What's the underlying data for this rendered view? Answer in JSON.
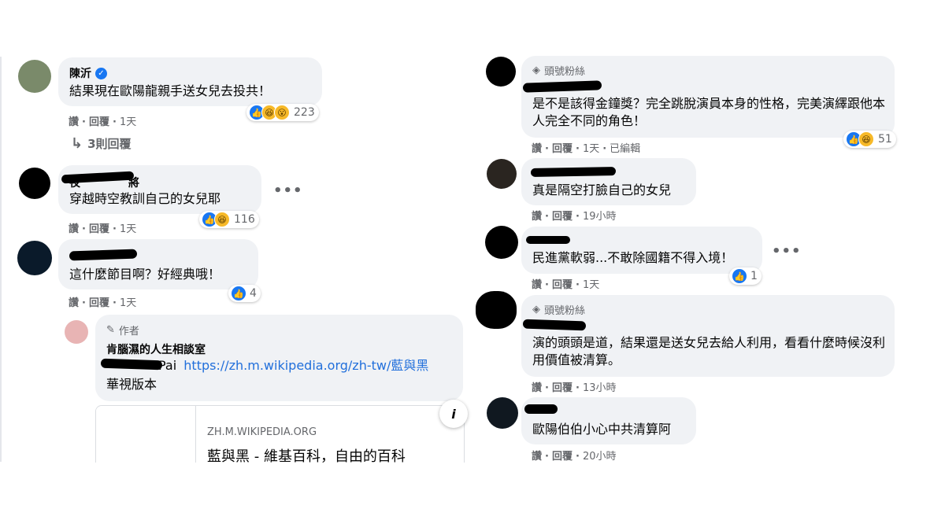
{
  "left": {
    "c1": {
      "name": "陳沂",
      "text": "結果現在歐陽龍親手送女兒去投共！",
      "reactions": "223",
      "actions": [
        "讚",
        "·",
        "回覆",
        "·",
        "1天"
      ],
      "replies_label": "3則回覆"
    },
    "c2": {
      "name_partial": "夜",
      "name_tail": "將",
      "text": "穿越時空教訓自己的女兒耶",
      "reactions": "116",
      "actions": [
        "讚",
        "·",
        "回覆",
        "·",
        "1天"
      ]
    },
    "c3": {
      "text": "這什麼節目啊？好經典哦！",
      "reactions": "4",
      "actions": [
        "讚",
        "·",
        "回覆",
        "·",
        "1天"
      ]
    },
    "author_reply": {
      "badge": "作者",
      "name": "肯腦濕的人生相談室",
      "partial": "Pai",
      "link": "https://zh.m.wikipedia.org/zh-tw/藍與黑",
      "line2": "華視版本",
      "preview_domain": "ZH.M.WIKIPEDIA.ORG",
      "preview_title": "藍與黑 - 維基百科，自由的百科",
      "info": "i"
    }
  },
  "right": {
    "r1": {
      "badge": "頭號粉絲",
      "text": "是不是該得金鐘獎？完全跳脫演員本身的性格，完美演繹跟他本人完全不同的角色！",
      "reactions": "51",
      "actions": [
        "讚",
        "·",
        "回覆",
        "·",
        "1天",
        "·",
        "已編輯"
      ]
    },
    "r2": {
      "text": "真是隔空打臉自己的女兒",
      "actions": [
        "讚",
        "·",
        "回覆",
        "·",
        "19小時"
      ]
    },
    "r3": {
      "text": "民進黨軟弱...不敢除國籍不得入境！",
      "reactions": "1",
      "actions": [
        "讚",
        "·",
        "回覆",
        "·",
        "1天"
      ]
    },
    "r4": {
      "badge": "頭號粉絲",
      "text": "演的頭頭是道，結果還是送女兒去給人利用，看看什麼時候沒利用價值被清算。",
      "actions": [
        "讚",
        "·",
        "回覆",
        "·",
        "13小時"
      ]
    },
    "r5": {
      "text": "歐陽伯伯小心中共清算阿",
      "actions": [
        "讚",
        "·",
        "回覆",
        "·",
        "20小時"
      ]
    }
  },
  "icons": {
    "verified": "verified-badge-icon",
    "like": "like-icon",
    "haha": "haha-icon",
    "wow": "wow-icon",
    "more": "more-options-icon",
    "reply_arrow": "reply-arrow-icon",
    "pen": "pen-icon",
    "diamond": "diamond-icon"
  },
  "colors": {
    "link": "#216fdb",
    "verified": "#1877f2",
    "bubble": "#f0f2f5",
    "meta": "#65676b"
  }
}
